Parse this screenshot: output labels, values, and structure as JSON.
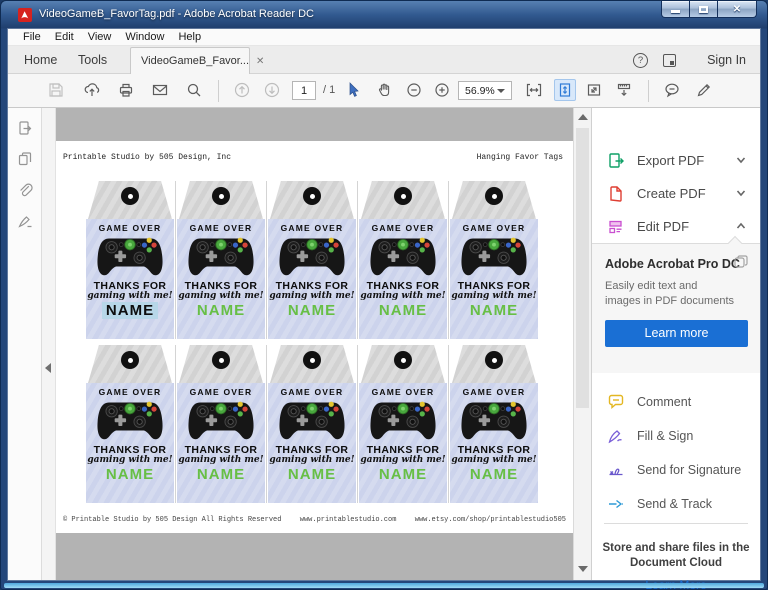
{
  "window": {
    "title": "VideoGameB_FavorTag.pdf - Adobe Acrobat Reader DC",
    "controls": {
      "minimize": "minimize",
      "maximize": "maximize",
      "close": "x"
    }
  },
  "menu": {
    "items": [
      "File",
      "Edit",
      "View",
      "Window",
      "Help"
    ]
  },
  "tab_bar": {
    "home": "Home",
    "tools": "Tools",
    "document_tab": "VideoGameB_Favor...",
    "close_glyph": "✕",
    "help_glyph": "?",
    "sign_in": "Sign In"
  },
  "toolbar": {
    "page_current": "1",
    "page_total": "/ 1",
    "zoom_level": "56.9%"
  },
  "document": {
    "header_left": "Printable Studio by 505 Design, Inc",
    "header_right": "Hanging Favor Tags",
    "tag": {
      "title": "GAME OVER",
      "thanks": "THANKS FOR",
      "script": "gaming with me!",
      "name": "NAME"
    },
    "grid": {
      "rows": 2,
      "cols": 5,
      "highlighted_name_index": 0
    },
    "footer_left": "© Printable Studio by 505 Design All Rights Reserved",
    "footer_center": "www.printablestudio.com",
    "footer_right": "www.etsy.com/shop/printablestudio505"
  },
  "sidebar": {
    "tools": [
      {
        "label": "Export PDF"
      },
      {
        "label": "Create PDF"
      },
      {
        "label": "Edit PDF"
      }
    ],
    "promo": {
      "title": "Adobe Acrobat Pro DC",
      "description": "Easily edit text and images in PDF documents",
      "button": "Learn more"
    },
    "actions": [
      {
        "label": "Comment"
      },
      {
        "label": "Fill & Sign"
      },
      {
        "label": "Send for Signature"
      },
      {
        "label": "Send & Track"
      }
    ],
    "cloud": {
      "text": "Store and share files in the Document Cloud",
      "link": "Learn More"
    }
  },
  "colors": {
    "accent": "#1a6fd4",
    "name-green": "#67bf45",
    "tag-body": "#ccd3ec",
    "canvas": "#b3b3b3",
    "highlight-blue": "#b7d7e8",
    "export-green": "#0fa066",
    "create-red": "#df3e32",
    "edit-magenta": "#c94fd0",
    "comment-yellow": "#e3b722",
    "fill-purple": "#7a5fd8",
    "signature-purple": "#6a58cc",
    "track-blue": "#2e9ad6"
  }
}
